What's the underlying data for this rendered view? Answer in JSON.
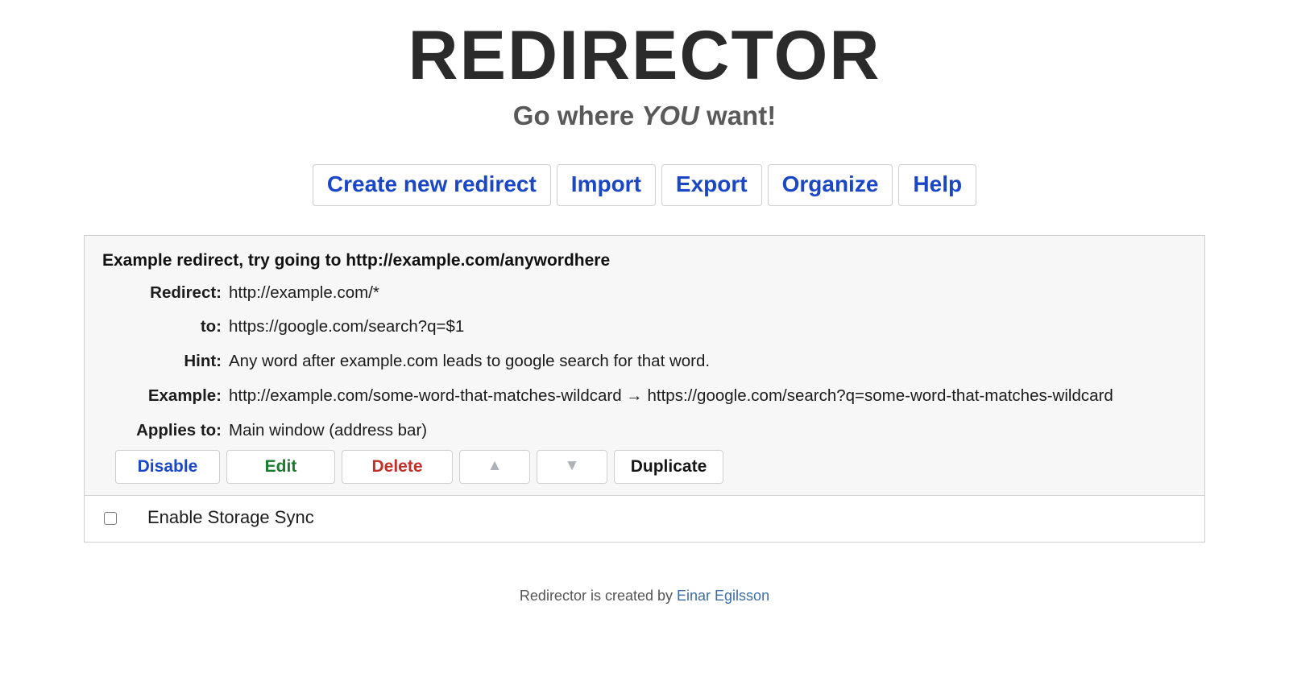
{
  "header": {
    "title": "REDIRECTOR",
    "subtitle_pre": "Go where ",
    "subtitle_emph": "YOU",
    "subtitle_post": " want!"
  },
  "toolbar": {
    "buttons": [
      {
        "label": "Create new redirect",
        "name": "create-new-redirect-button"
      },
      {
        "label": "Import",
        "name": "import-button"
      },
      {
        "label": "Export",
        "name": "export-button"
      },
      {
        "label": "Organize",
        "name": "organize-button"
      },
      {
        "label": "Help",
        "name": "help-button"
      }
    ]
  },
  "redirect": {
    "description": "Example redirect, try going to http://example.com/anywordhere",
    "labels": {
      "redirect": "Redirect:",
      "to": "to:",
      "hint": "Hint:",
      "example": "Example:",
      "applies_to": "Applies to:"
    },
    "values": {
      "redirect": "http://example.com/*",
      "to": "https://google.com/search?q=$1",
      "hint": "Any word after example.com leads to google search for that word.",
      "example": "http://example.com/some-word-that-matches-wildcard → https://google.com/search?q=some-word-that-matches-wildcard",
      "applies_to": "Main window (address bar)"
    },
    "actions": [
      {
        "label": "Disable",
        "name": "disable-button",
        "class": "act-disable"
      },
      {
        "label": "Edit",
        "name": "edit-button",
        "class": "act-edit"
      },
      {
        "label": "Delete",
        "name": "delete-button",
        "class": "act-delete"
      },
      {
        "label": "▲",
        "name": "move-up-button",
        "class": "act-arrow"
      },
      {
        "label": "▼",
        "name": "move-down-button",
        "class": "act-arrow"
      },
      {
        "label": "Duplicate",
        "name": "duplicate-button",
        "class": "act-dup"
      }
    ]
  },
  "storage_sync": {
    "label": "Enable Storage Sync",
    "checked": false
  },
  "footer": {
    "text": "Redirector is created by ",
    "author": "Einar Egilsson"
  },
  "colors": {
    "accent_blue": "#1a46c8",
    "edit_green": "#1a7a2e",
    "delete_red": "#c0302b",
    "arrow_gray": "#aeb2b6",
    "panel_bg": "#f7f7f7",
    "border": "#cfcfcf",
    "link_blue": "#3a6ea5"
  }
}
